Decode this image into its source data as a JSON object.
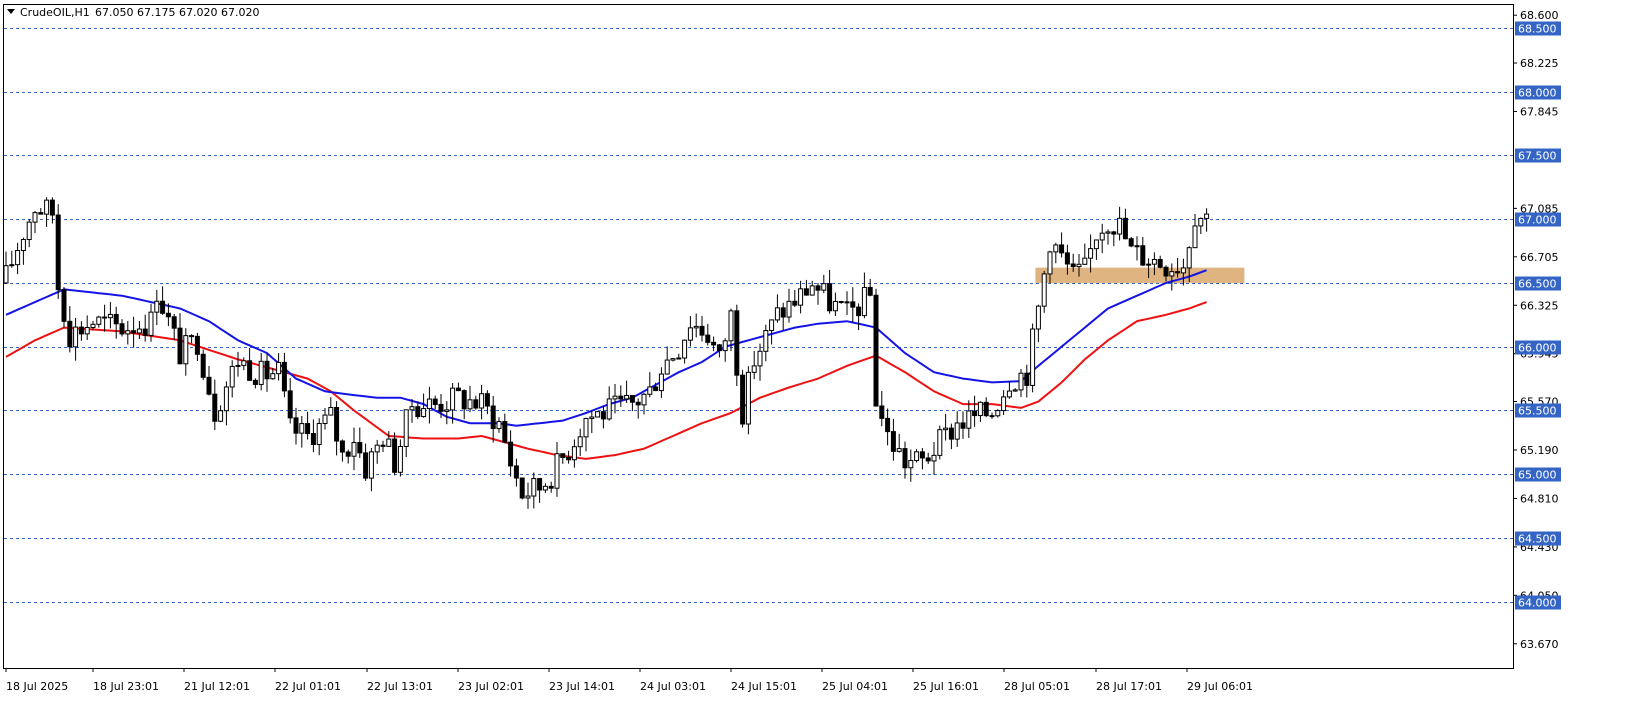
{
  "header": {
    "symbol": "CrudeOIL,H1",
    "ohlc": "67.050 67.175 67.020 67.020"
  },
  "colors": {
    "background": "#ffffff",
    "frame": "#000000",
    "candle_bull": "#ffffff",
    "candle_bear": "#000000",
    "candle_outline": "#000000",
    "ma_fast": "#1414e6",
    "ma_slow": "#ee1111",
    "level_line": "#3c64c8",
    "level_tag_bg": "#3465c4",
    "zone": "#d9a76a"
  },
  "chart_data": {
    "type": "candlestick",
    "ylim": [
      63.48,
      68.68
    ],
    "y_ticks": [
      "68.600",
      "68.225",
      "67.845",
      "67.085",
      "66.705",
      "66.325",
      "65.945",
      "65.570",
      "65.190",
      "64.810",
      "64.430",
      "64.050",
      "63.670"
    ],
    "levels": [
      "68.500",
      "68.000",
      "67.500",
      "67.000",
      "66.500",
      "66.000",
      "65.500",
      "65.000",
      "64.500",
      "64.000"
    ],
    "x_labels": [
      "18 Jul 2025",
      "18 Jul 23:01",
      "21 Jul 12:01",
      "22 Jul 01:01",
      "22 Jul 13:01",
      "23 Jul 02:01",
      "23 Jul 14:01",
      "24 Jul 03:01",
      "24 Jul 15:01",
      "25 Jul 04:01",
      "25 Jul 16:01",
      "28 Jul 05:01",
      "28 Jul 17:01",
      "29 Jul 06:01"
    ],
    "zone": {
      "y_low": 66.5,
      "y_high": 66.62,
      "from_bar": 178,
      "to_bar": 213
    },
    "anchors": [
      [
        0,
        66.55
      ],
      [
        3,
        66.9
      ],
      [
        5,
        67.1
      ],
      [
        8,
        67.05
      ],
      [
        9,
        66.48
      ],
      [
        11,
        66.1
      ],
      [
        15,
        66.2
      ],
      [
        20,
        66.15
      ],
      [
        25,
        66.2
      ],
      [
        26,
        66.45
      ],
      [
        30,
        65.95
      ],
      [
        33,
        66.05
      ],
      [
        36,
        65.5
      ],
      [
        40,
        65.9
      ],
      [
        44,
        65.78
      ],
      [
        47,
        65.8
      ],
      [
        49,
        65.35
      ],
      [
        52,
        65.3
      ],
      [
        56,
        65.45
      ],
      [
        58,
        65.15
      ],
      [
        60,
        65.3
      ],
      [
        62,
        65.05
      ],
      [
        65,
        65.3
      ],
      [
        67,
        65.1
      ],
      [
        70,
        65.55
      ],
      [
        74,
        65.55
      ],
      [
        78,
        65.6
      ],
      [
        82,
        65.55
      ],
      [
        85,
        65.4
      ],
      [
        87,
        65.1
      ],
      [
        89,
        64.85
      ],
      [
        92,
        64.9
      ],
      [
        94,
        65.0
      ],
      [
        97,
        65.2
      ],
      [
        100,
        65.45
      ],
      [
        104,
        65.5
      ],
      [
        108,
        65.55
      ],
      [
        111,
        65.65
      ],
      [
        113,
        65.85
      ],
      [
        116,
        66.0
      ],
      [
        118,
        66.2
      ],
      [
        121,
        66.1
      ],
      [
        123,
        65.9
      ],
      [
        125,
        66.25
      ],
      [
        127,
        65.5
      ],
      [
        129,
        65.9
      ],
      [
        133,
        66.25
      ],
      [
        137,
        66.4
      ],
      [
        139,
        66.5
      ],
      [
        142,
        66.35
      ],
      [
        145,
        66.25
      ],
      [
        149,
        66.4
      ],
      [
        150,
        65.6
      ],
      [
        152,
        65.3
      ],
      [
        155,
        65.1
      ],
      [
        158,
        65.1
      ],
      [
        161,
        65.25
      ],
      [
        164,
        65.4
      ],
      [
        167,
        65.45
      ],
      [
        170,
        65.5
      ],
      [
        173,
        65.75
      ],
      [
        176,
        65.8
      ],
      [
        178,
        66.3
      ],
      [
        180,
        66.85
      ],
      [
        182,
        66.7
      ],
      [
        184,
        66.55
      ],
      [
        186,
        66.6
      ],
      [
        188,
        66.9
      ],
      [
        190,
        67.0
      ],
      [
        192,
        66.95
      ],
      [
        194,
        66.75
      ],
      [
        197,
        66.7
      ],
      [
        200,
        66.65
      ],
      [
        203,
        66.65
      ],
      [
        205,
        67.05
      ],
      [
        207,
        67.02
      ]
    ],
    "ma_fast": [
      [
        0,
        66.25
      ],
      [
        10,
        66.45
      ],
      [
        20,
        66.4
      ],
      [
        30,
        66.3
      ],
      [
        35,
        66.2
      ],
      [
        40,
        66.05
      ],
      [
        45,
        65.95
      ],
      [
        50,
        65.75
      ],
      [
        55,
        65.65
      ],
      [
        60,
        65.62
      ],
      [
        64,
        65.6
      ],
      [
        68,
        65.6
      ],
      [
        72,
        65.55
      ],
      [
        76,
        65.45
      ],
      [
        80,
        65.4
      ],
      [
        85,
        65.4
      ],
      [
        88,
        65.38
      ],
      [
        92,
        65.4
      ],
      [
        96,
        65.42
      ],
      [
        100,
        65.48
      ],
      [
        104,
        65.55
      ],
      [
        108,
        65.6
      ],
      [
        112,
        65.7
      ],
      [
        116,
        65.8
      ],
      [
        120,
        65.88
      ],
      [
        124,
        66.0
      ],
      [
        128,
        66.05
      ],
      [
        132,
        66.1
      ],
      [
        136,
        66.15
      ],
      [
        140,
        66.18
      ],
      [
        145,
        66.2
      ],
      [
        150,
        66.15
      ],
      [
        155,
        65.95
      ],
      [
        160,
        65.8
      ],
      [
        165,
        65.75
      ],
      [
        170,
        65.72
      ],
      [
        175,
        65.73
      ],
      [
        178,
        65.85
      ],
      [
        182,
        66.0
      ],
      [
        186,
        66.15
      ],
      [
        190,
        66.3
      ],
      [
        195,
        66.4
      ],
      [
        200,
        66.5
      ],
      [
        204,
        66.55
      ],
      [
        207,
        66.6
      ]
    ],
    "ma_slow": [
      [
        0,
        65.92
      ],
      [
        5,
        66.05
      ],
      [
        10,
        66.15
      ],
      [
        20,
        66.12
      ],
      [
        30,
        66.05
      ],
      [
        40,
        65.9
      ],
      [
        48,
        65.8
      ],
      [
        52,
        65.75
      ],
      [
        56,
        65.65
      ],
      [
        60,
        65.5
      ],
      [
        66,
        65.3
      ],
      [
        72,
        65.28
      ],
      [
        78,
        65.28
      ],
      [
        82,
        65.3
      ],
      [
        86,
        65.25
      ],
      [
        90,
        65.2
      ],
      [
        95,
        65.15
      ],
      [
        100,
        65.12
      ],
      [
        105,
        65.15
      ],
      [
        110,
        65.2
      ],
      [
        115,
        65.3
      ],
      [
        120,
        65.4
      ],
      [
        125,
        65.48
      ],
      [
        130,
        65.6
      ],
      [
        135,
        65.68
      ],
      [
        140,
        65.75
      ],
      [
        145,
        65.85
      ],
      [
        150,
        65.93
      ],
      [
        155,
        65.8
      ],
      [
        160,
        65.65
      ],
      [
        165,
        65.55
      ],
      [
        170,
        65.55
      ],
      [
        175,
        65.52
      ],
      [
        178,
        65.57
      ],
      [
        182,
        65.72
      ],
      [
        186,
        65.9
      ],
      [
        190,
        66.05
      ],
      [
        195,
        66.2
      ],
      [
        200,
        66.25
      ],
      [
        204,
        66.3
      ],
      [
        207,
        66.35
      ]
    ]
  }
}
